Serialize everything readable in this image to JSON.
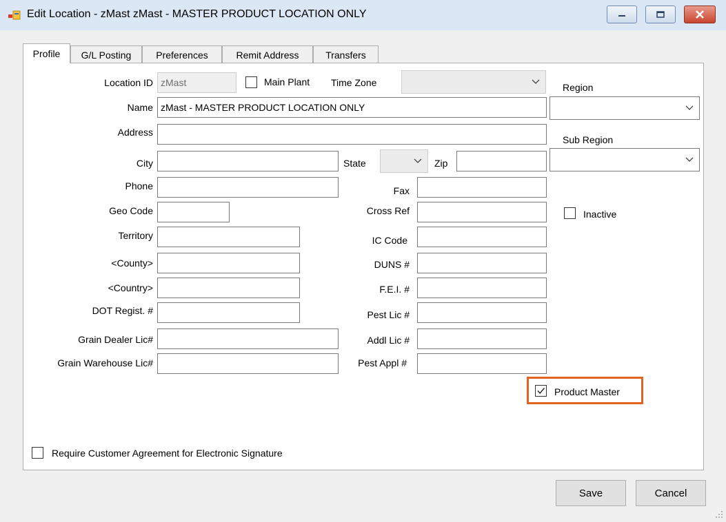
{
  "window": {
    "title": "Edit Location - zMast    zMast - MASTER PRODUCT LOCATION ONLY"
  },
  "tabs": [
    {
      "label": "Profile",
      "active": true
    },
    {
      "label": "G/L Posting"
    },
    {
      "label": "Preferences"
    },
    {
      "label": "Remit Address"
    },
    {
      "label": "Transfers"
    }
  ],
  "form": {
    "location_id": {
      "label": "Location ID",
      "value": "zMast"
    },
    "main_plant": {
      "label": "Main Plant",
      "checked": false
    },
    "time_zone": {
      "label": "Time Zone",
      "value": ""
    },
    "region": {
      "label": "Region",
      "value": ""
    },
    "name": {
      "label": "Name",
      "value": "zMast - MASTER PRODUCT LOCATION ONLY"
    },
    "address": {
      "label": "Address",
      "value": ""
    },
    "sub_region": {
      "label": "Sub Region",
      "value": ""
    },
    "city": {
      "label": "City",
      "value": ""
    },
    "state": {
      "label": "State",
      "value": ""
    },
    "zip": {
      "label": "Zip",
      "value": ""
    },
    "phone": {
      "label": "Phone",
      "value": ""
    },
    "fax": {
      "label": "Fax",
      "value": ""
    },
    "geo_code": {
      "label": "Geo Code",
      "value": ""
    },
    "cross_ref": {
      "label": "Cross Ref",
      "value": ""
    },
    "inactive": {
      "label": "Inactive",
      "checked": false
    },
    "territory": {
      "label": "Territory",
      "value": ""
    },
    "ic_code": {
      "label": "IC Code",
      "value": ""
    },
    "county": {
      "label": "<County>",
      "value": ""
    },
    "duns": {
      "label": "DUNS #",
      "value": ""
    },
    "country": {
      "label": "<Country>",
      "value": ""
    },
    "fei": {
      "label": "F.E.I. #",
      "value": ""
    },
    "dot_regist": {
      "label": "DOT Regist. #",
      "value": ""
    },
    "pest_lic": {
      "label": "Pest Lic #",
      "value": ""
    },
    "grain_dealer_lic": {
      "label": "Grain Dealer Lic#",
      "value": ""
    },
    "addl_lic": {
      "label": "Addl Lic #",
      "value": ""
    },
    "grain_warehouse_lic": {
      "label": "Grain Warehouse Lic#",
      "value": ""
    },
    "pest_appl": {
      "label": "Pest Appl #",
      "value": ""
    },
    "product_master": {
      "label": "Product Master",
      "checked": true
    },
    "require_agreement": {
      "label": "Require Customer Agreement for Electronic Signature",
      "checked": false
    }
  },
  "buttons": {
    "save": "Save",
    "cancel": "Cancel"
  },
  "colors": {
    "highlight": "#e2631f",
    "titlebar": "#dbe7f4",
    "close_button": "#c9452f"
  }
}
